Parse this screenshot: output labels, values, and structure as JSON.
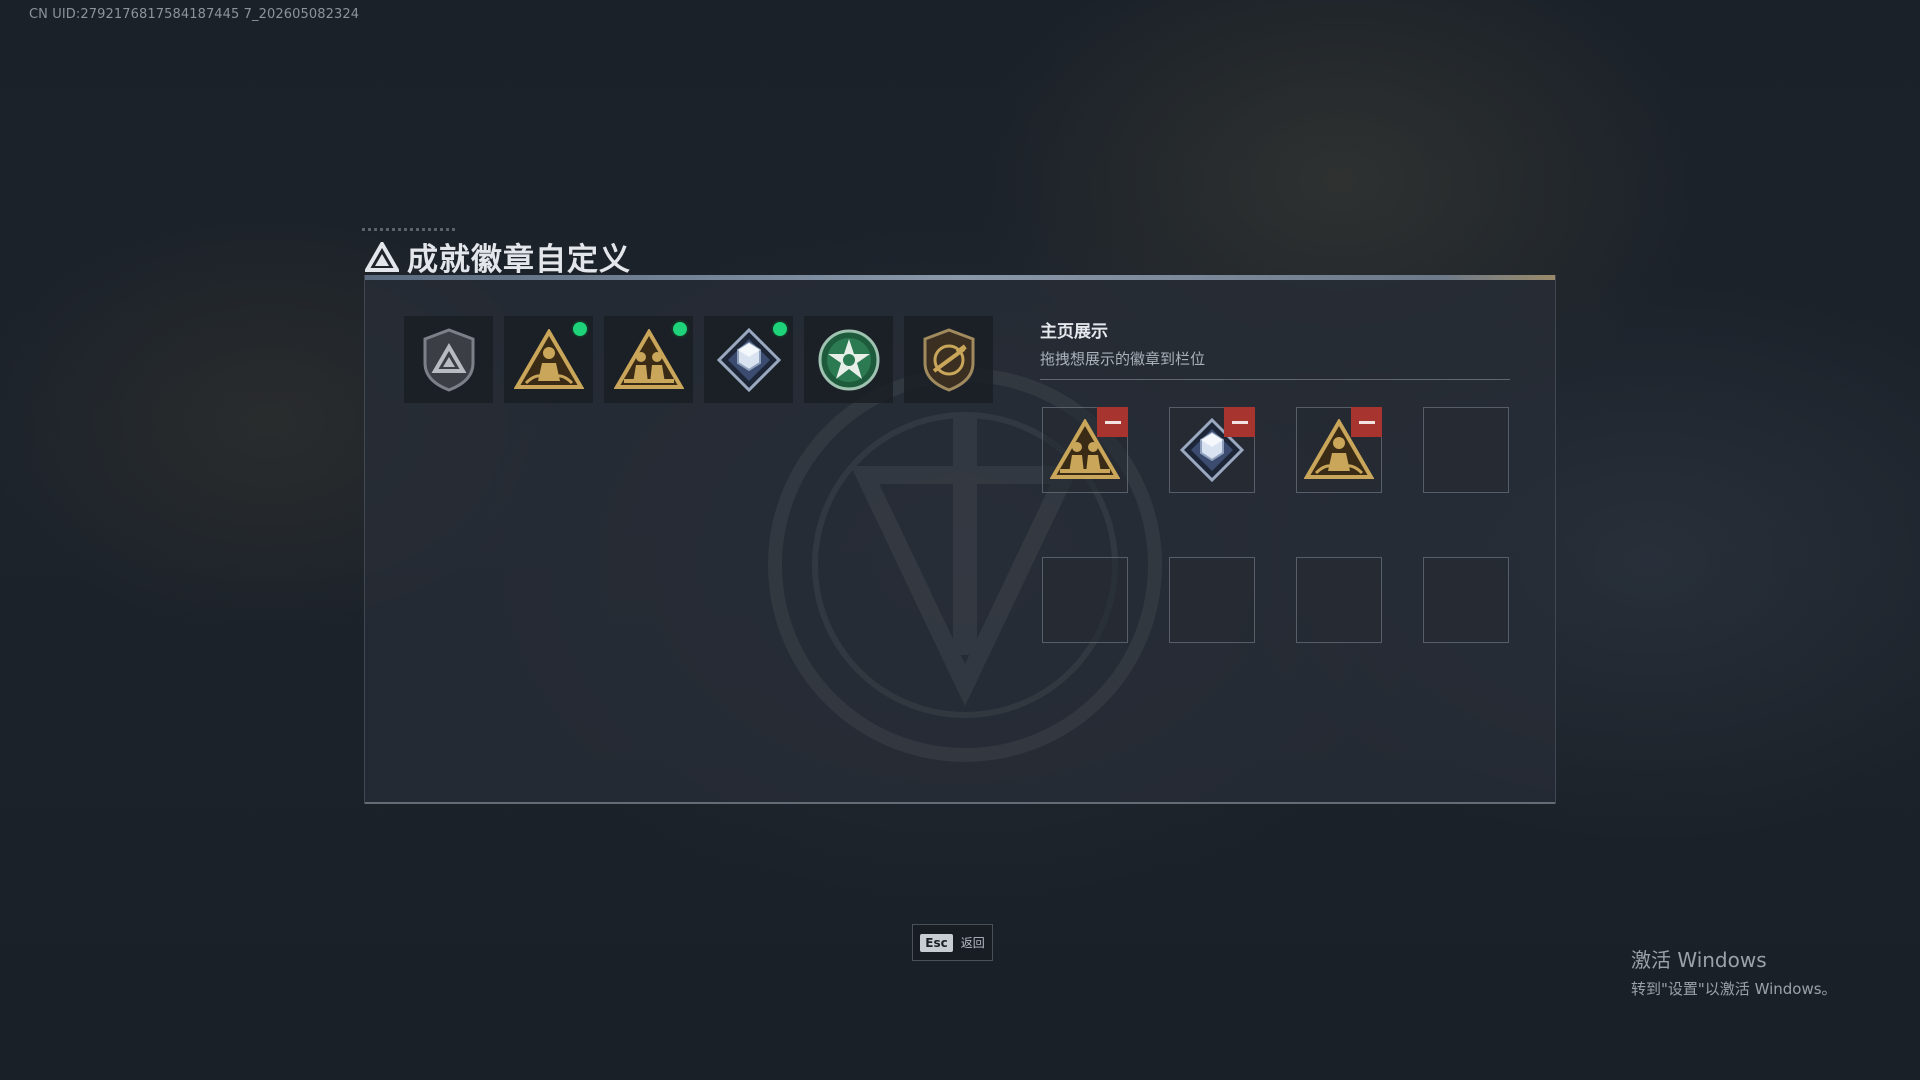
{
  "uid_text": "CN UID:2792176817584187445 7_202605082324",
  "title": "成就徽章自定义",
  "owned_badges": [
    {
      "icon": "shield-triangle-badge-icon",
      "new": false
    },
    {
      "icon": "soldier-triangle-badge-icon",
      "new": true
    },
    {
      "icon": "soldiers-triangle-badge-icon",
      "new": true
    },
    {
      "icon": "crystal-diamond-badge-icon",
      "new": true
    },
    {
      "icon": "green-star-badge-icon",
      "new": false
    },
    {
      "icon": "rifle-shield-badge-icon",
      "new": false
    }
  ],
  "display": {
    "title": "主页展示",
    "subtitle": "拖拽想展示的徽章到栏位",
    "slots": [
      {
        "icon": "soldiers-triangle-badge-icon"
      },
      {
        "icon": "crystal-diamond-badge-icon"
      },
      {
        "icon": "soldier-triangle-badge-icon"
      },
      {
        "icon": ""
      },
      {
        "icon": ""
      },
      {
        "icon": ""
      },
      {
        "icon": ""
      },
      {
        "icon": ""
      }
    ]
  },
  "footer": {
    "key": "Esc",
    "label": "返回"
  },
  "activation": {
    "line1": "激活 Windows",
    "line2": "转到\"设置\"以激活 Windows。"
  },
  "colors": {
    "new_dot": "#1ed37a",
    "remove": "#a8342f",
    "gold": "#c9a659"
  }
}
